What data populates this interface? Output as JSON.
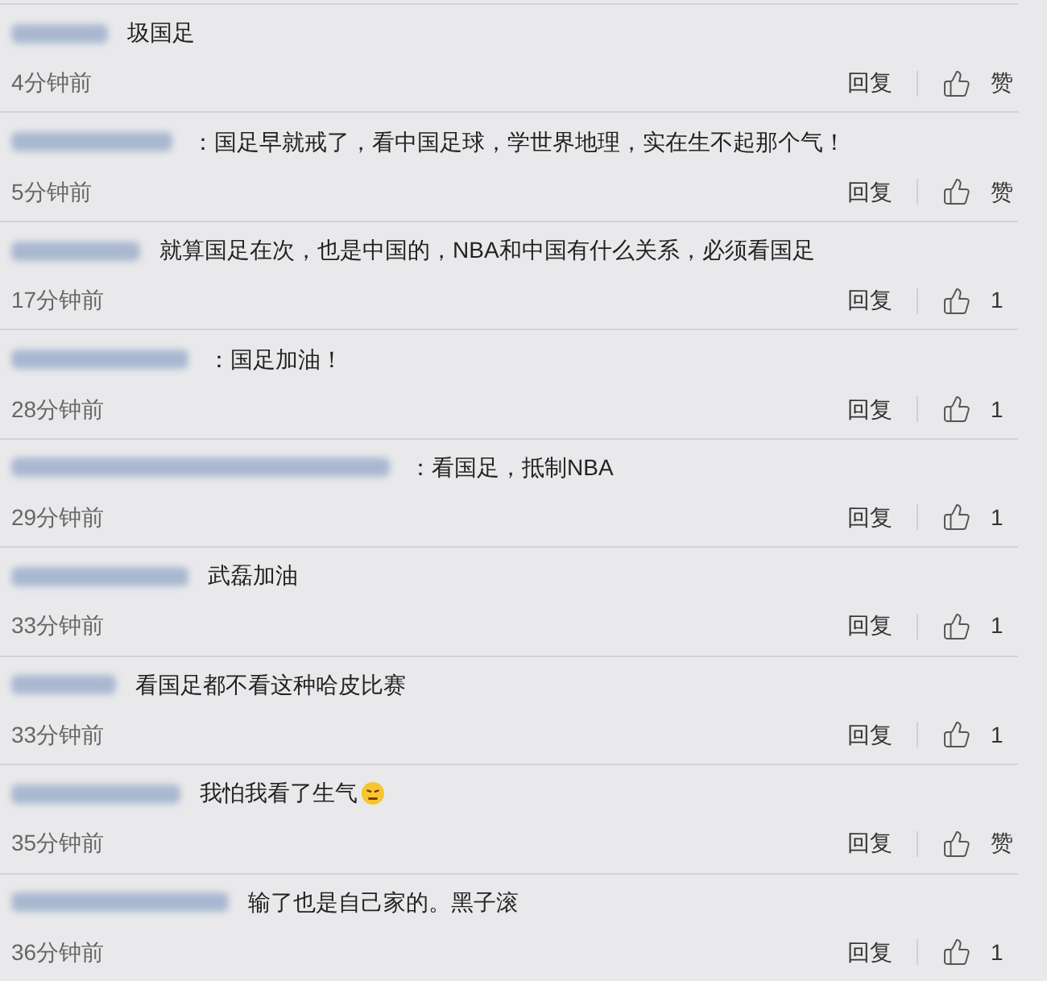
{
  "comments": [
    {
      "text": "圾国足",
      "has_emoji": false,
      "time": "4分钟前",
      "reply": "回复",
      "likes": "赞"
    },
    {
      "text": "：国足早就戒了，看中国足球，学世界地理，实在生不起那个气！",
      "has_emoji": false,
      "time": "5分钟前",
      "reply": "回复",
      "likes": "赞"
    },
    {
      "text": "就算国足在次，也是中国的，NBA和中国有什么关系，必须看国足",
      "has_emoji": false,
      "time": "17分钟前",
      "reply": "回复",
      "likes": "1"
    },
    {
      "text": "：国足加油！",
      "has_emoji": false,
      "time": "28分钟前",
      "reply": "回复",
      "likes": "1"
    },
    {
      "text": "：看国足，抵制NBA",
      "has_emoji": false,
      "time": "29分钟前",
      "reply": "回复",
      "likes": "1"
    },
    {
      "text": "武磊加油",
      "has_emoji": false,
      "time": "33分钟前",
      "reply": "回复",
      "likes": "1"
    },
    {
      "text": "看国足都不看这种哈皮比赛",
      "has_emoji": false,
      "time": "33分钟前",
      "reply": "回复",
      "likes": "1"
    },
    {
      "text": "我怕我看了生气",
      "has_emoji": true,
      "time": "35分钟前",
      "reply": "回复",
      "likes": "赞"
    },
    {
      "text": "输了也是自己家的。黑子滚",
      "has_emoji": false,
      "time": "36分钟前",
      "reply": "回复",
      "likes": "1"
    }
  ]
}
